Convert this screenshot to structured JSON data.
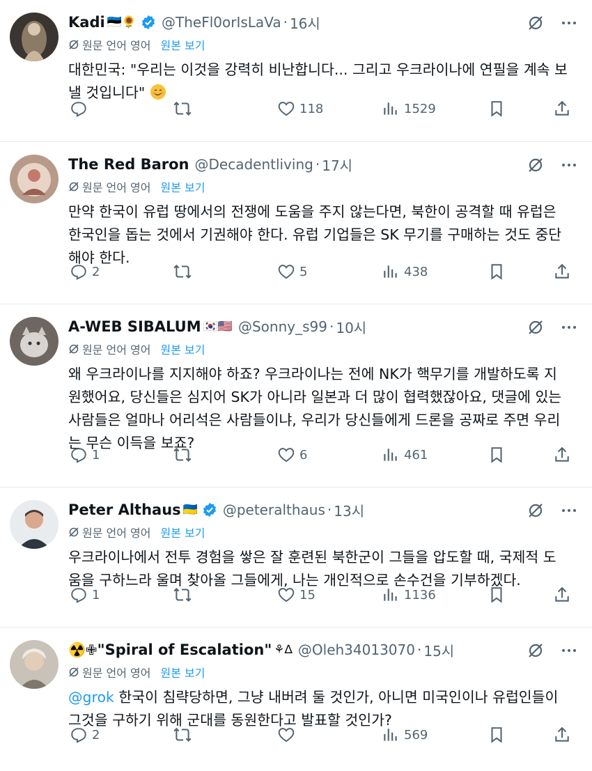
{
  "translate_label": "원문 언어 영어",
  "view_original": "원본 보기",
  "tweets": [
    {
      "name": "Kadi",
      "flags": "🇪🇪🌻",
      "verified": true,
      "handle": "@TheFl0orIsLaVa",
      "time": "16시",
      "text": "대한민국: \"우리는 이것을 강력히 비난합니다... 그리고 우크라이나에 연필을 계속 보\n낼 것입니다\"",
      "replies": "",
      "retweets": "",
      "likes": "118",
      "views": "1529"
    },
    {
      "name": "The Red Baron",
      "flags": "",
      "verified": false,
      "handle": "@Decadentliving",
      "time": "17시",
      "text": "만약 한국이 유럽 땅에서의 전쟁에 도움을 주지 않는다면, 북한이 공격할 때 유럽은\n한국인을 돕는 것에서 기권해야 한다. 유럽 기업들은 SK 무기를 구매하는 것도 중단\n해야 한다.",
      "replies": "2",
      "retweets": "",
      "likes": "5",
      "views": "438"
    },
    {
      "name": "A-WEB SIBALUM",
      "flags": "🇰🇷🇺🇸",
      "verified": false,
      "handle": "@Sonny_s99",
      "time": "10시",
      "text": "왜 우크라이나를 지지해야 하죠? 우크라이나는 전에 NK가 핵무기를 개발하도록 지\n원했어요, 당신들은 심지어 SK가 아니라 일본과 더 많이 협력했잖아요, 댓글에 있는\n사람들은 얼마나 어리석은 사람들이냐, 우리가 당신들에게 드론을 공짜로 주면 우리\n는 무슨 이득을 보죠?",
      "replies": "1",
      "retweets": "",
      "likes": "6",
      "views": "461"
    },
    {
      "name": "Peter Althaus",
      "flags": "🇺🇦",
      "verified": true,
      "handle": "@peteralthaus",
      "time": "13시",
      "text": "우크라이나에서 전투 경험을 쌓은 잘 훈련된 북한군이 그들을 압도할 때, 국제적 도\n움을 구하느라 울며 찾아올 그들에게, 나는 개인적으로 손수건을 기부하겠다.",
      "replies": "1",
      "retweets": "",
      "likes": "15",
      "views": "1136"
    },
    {
      "name": "\"Spiral of Escalation\"",
      "prefix": "☢️✙",
      "flags": "⚘∆",
      "verified": false,
      "handle": "@Oleh34013070",
      "time": "15시",
      "mention": "@grok",
      "text": " 한국이 침략당하면, 그냥 내버려 둘 것인가, 아니면 미국인이나 유럽인들이\n그것을 구하기 위해 군대를 동원한다고 발표할 것인가?",
      "replies": "2",
      "retweets": "",
      "likes": "",
      "views": "569"
    }
  ],
  "colors": {
    "accent": "#1d9bf0",
    "secondary": "#536471",
    "text": "#0f1419"
  },
  "icons": [
    "reply-icon",
    "retweet-icon",
    "like-icon",
    "views-icon",
    "bookmark-icon",
    "share-icon",
    "grok-icon",
    "more-icon",
    "translate-icon",
    "verified-icon"
  ]
}
